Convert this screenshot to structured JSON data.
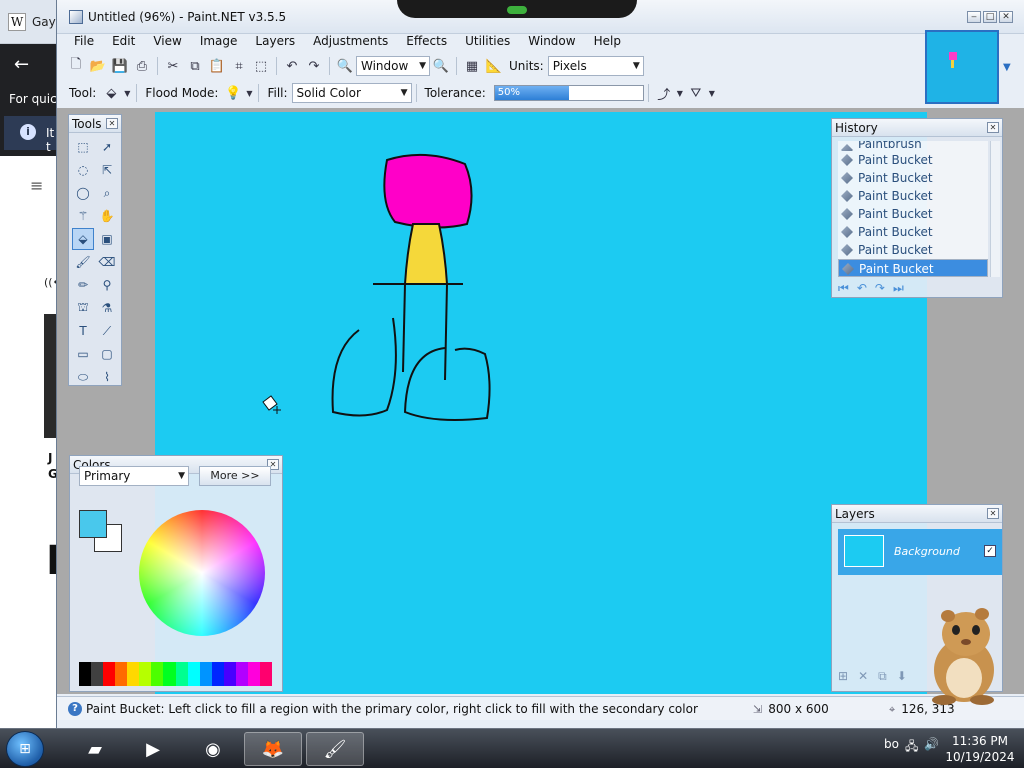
{
  "browser_bg": {
    "tab_text": "Gay",
    "quick_text": "For quick",
    "info_text": "It t",
    "side_text_j": "J",
    "side_text_g": "G",
    "side_text_big": "E"
  },
  "window": {
    "title": "Untitled (96%) - Paint.NET v3.5.5",
    "min_label": "‒",
    "max_label": "□",
    "close_label": "✕"
  },
  "menu": [
    "File",
    "Edit",
    "View",
    "Image",
    "Layers",
    "Adjustments",
    "Effects",
    "Utilities",
    "Window",
    "Help"
  ],
  "toolbar1": {
    "zoom_value": "Window",
    "units_label": "Units:",
    "units_value": "Pixels"
  },
  "toolbar2": {
    "tool_label": "Tool:",
    "flood_label": "Flood Mode:",
    "fill_label": "Fill:",
    "fill_value": "Solid Color",
    "tolerance_label": "Tolerance:",
    "tolerance_value": "50%",
    "tolerance_fraction": 0.5
  },
  "tools_panel": {
    "title": "Tools"
  },
  "colors_panel": {
    "title": "Colors",
    "select_value": "Primary",
    "more_button": "More >>",
    "primary_color": "#49c8ec",
    "secondary_color": "#ffffff",
    "palette": [
      "#000000",
      "#404040",
      "#ff0000",
      "#ff6a00",
      "#ffd800",
      "#b6ff00",
      "#4cff00",
      "#00ff21",
      "#00ff90",
      "#00ffff",
      "#0094ff",
      "#0026ff",
      "#4800ff",
      "#b200ff",
      "#ff00dc",
      "#ff006e"
    ]
  },
  "history_panel": {
    "title": "History",
    "items": [
      "Paintbrush",
      "Paint Bucket",
      "Paint Bucket",
      "Paint Bucket",
      "Paint Bucket",
      "Paint Bucket",
      "Paint Bucket",
      "Paint Bucket"
    ]
  },
  "layers_panel": {
    "title": "Layers",
    "layer_name": "Background",
    "layer_visible_mark": "✓"
  },
  "canvas": {
    "background_color": "#1ccbf2",
    "head_color": "#ff00c8",
    "body_color": "#f5d83a"
  },
  "status": {
    "help_icon": "?",
    "message": "Paint Bucket: Left click to fill a region with the primary color, right click to fill with the secondary color",
    "image_size": "800 x 600",
    "cursor_pos": "126, 313"
  },
  "taskbar": {
    "time": "11:36 PM",
    "date": "10/19/2024",
    "tray_text": "bo"
  }
}
